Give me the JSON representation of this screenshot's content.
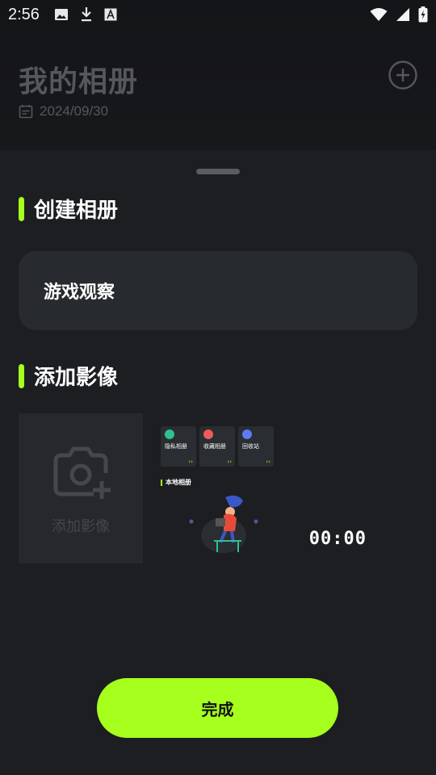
{
  "status_bar": {
    "time": "2:56",
    "left_icons": [
      "image-icon",
      "download-icon",
      "font-icon"
    ],
    "right_icons": [
      "wifi-icon",
      "signal-icon",
      "battery-icon"
    ]
  },
  "header": {
    "title": "我的相册",
    "date": "2024/09/30",
    "add_icon": "plus-circle-icon"
  },
  "sheet": {
    "create_section_title": "创建相册",
    "album_name_value": "游戏观察",
    "add_media_section_title": "添加影像",
    "add_media_label": "添加影像",
    "thumbnail": {
      "cards": [
        {
          "label": "隐私相册",
          "color": "#2fc08e"
        },
        {
          "label": "收藏相册",
          "color": "#f05a5a"
        },
        {
          "label": "回收站",
          "color": "#5b7cf5"
        }
      ],
      "section_title": "本地相册",
      "duration": "00:00"
    },
    "done_label": "完成"
  },
  "colors": {
    "accent": "#a6ff1c",
    "background": "#1c1e21",
    "field": "#272a2e"
  }
}
